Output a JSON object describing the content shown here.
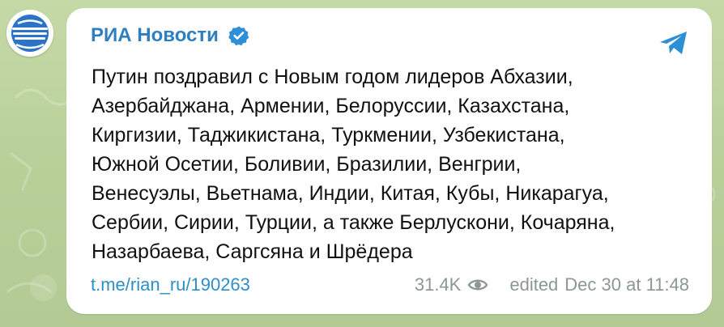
{
  "channel": {
    "name": "РИА Новости",
    "verified_icon": "verified-badge-icon",
    "avatar_icon": "ria-globe-logo-icon",
    "share_icon": "telegram-share-icon",
    "accent_color": "#2d7fc1"
  },
  "message": {
    "text": "Путин поздравил с Новым годом лидеров Абхазии,\nАзербайджана, Армении, Белоруссии, Казахстана,\nКиргизии, Таджикистана, Туркмении, Узбекистана,\nЮжной Осетии, Боливии, Бразилии, Венгрии,\nВенесуэлы, Вьетнама, Индии, Китая, Кубы, Никарагуа,\nСербии, Сирии, Турции, а также Берлускони, Кочаряна,\nНазарбаева, Саргсяна и Шрёдера",
    "link": "t.me/rian_ru/190263",
    "views": "31.4K",
    "views_icon": "eye-icon",
    "edited": "edited",
    "date_time": "Dec 30 at 11:48"
  },
  "colors": {
    "wallpaper": "#b9cf9a",
    "bubble": "#ffffff",
    "link": "#2d8fc7",
    "meta": "#8d9697"
  }
}
